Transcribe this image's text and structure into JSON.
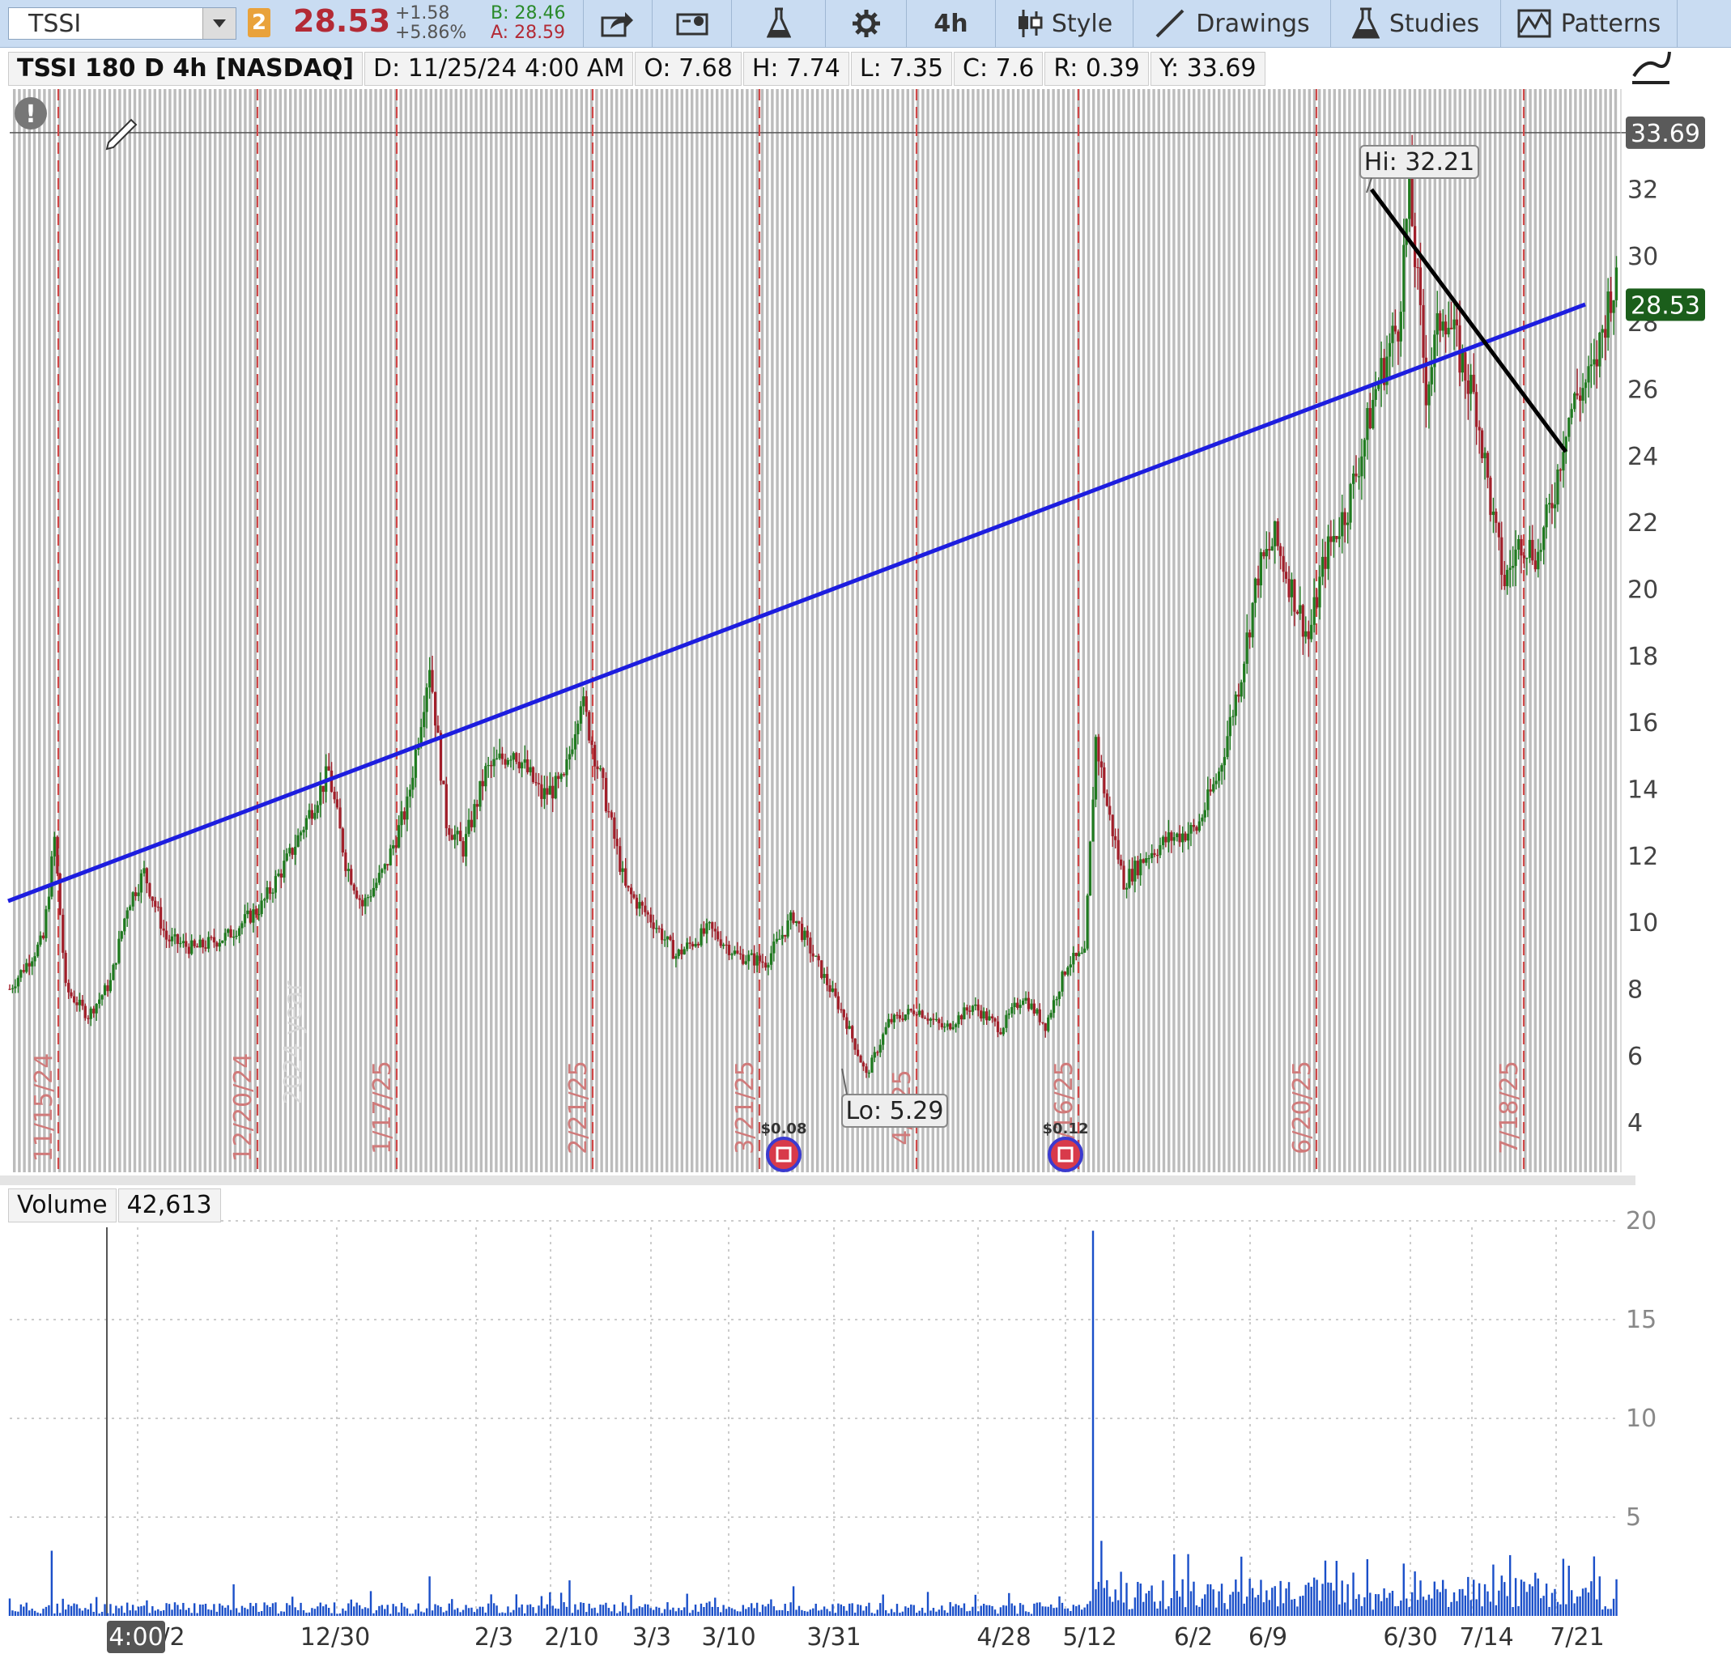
{
  "toolbar": {
    "symbol": "TSSI",
    "link_badge": "2",
    "last_price": "28.53",
    "change": "+1.58",
    "change_pct": "+5.86%",
    "bid": "B: 28.46",
    "ask": "A: 28.59",
    "timeframe": "4h",
    "style_label": "Style",
    "drawings_label": "Drawings",
    "studies_label": "Studies",
    "patterns_label": "Patterns",
    "colors": {
      "bid": "#2a8a2a",
      "ask": "#b32a35",
      "last": "#b32a35"
    }
  },
  "info": {
    "title": "TSSI 180 D 4h [NASDAQ]",
    "date": "D: 11/25/24 4:00 AM",
    "open": "O: 7.68",
    "high": "H: 7.74",
    "low": "L: 7.35",
    "close": "C: 7.6",
    "range": "R: 0.39",
    "cursor_y": "Y: 33.69"
  },
  "volume_panel": {
    "label": "Volume",
    "value": "42,613"
  },
  "chart_data": {
    "type": "candlestick",
    "symbol": "TSSI",
    "interval": "4h",
    "y_range": [
      2.5,
      35
    ],
    "y_ticks": [
      4,
      6,
      8,
      10,
      12,
      14,
      16,
      18,
      20,
      22,
      24,
      26,
      28,
      30,
      32
    ],
    "crosshair_value": "33.69",
    "last_price_label": "28.53",
    "hi_label": "Hi: 32.21",
    "lo_label": "Lo: 5.29",
    "x_tick_labels": [
      "/2",
      "12/30",
      "2/3",
      "2/10",
      "3/3",
      "3/10",
      "3/31",
      "4/28",
      "5/12",
      "6/2",
      "6/9",
      "6/30",
      "7/14",
      "7/21"
    ],
    "time_cursor_label": "4:00",
    "period_markers": [
      "11/15/24",
      "12/20/24",
      "1/17/25",
      "2/21/25",
      "3/21/25",
      "4/?/25",
      "5/16/25",
      "6/20/25",
      "7/18/25"
    ],
    "year_marker": "2024 year",
    "dividends": [
      {
        "date": "3/21/25",
        "label": "$0.08"
      },
      {
        "date": "5/12/25",
        "label": "$0.12"
      }
    ],
    "price_path": [
      [
        0,
        8.0
      ],
      [
        12,
        9.5
      ],
      [
        16,
        12.5
      ],
      [
        20,
        8.0
      ],
      [
        28,
        7.2
      ],
      [
        36,
        8.2
      ],
      [
        42,
        10.5
      ],
      [
        48,
        11.5
      ],
      [
        56,
        9.5
      ],
      [
        66,
        9.2
      ],
      [
        78,
        9.6
      ],
      [
        90,
        10.5
      ],
      [
        100,
        12.0
      ],
      [
        110,
        13.8
      ],
      [
        114,
        14.5
      ],
      [
        120,
        11.8
      ],
      [
        126,
        10.5
      ],
      [
        134,
        11.6
      ],
      [
        142,
        13.5
      ],
      [
        150,
        17.8
      ],
      [
        156,
        13.0
      ],
      [
        162,
        12.2
      ],
      [
        170,
        14.5
      ],
      [
        180,
        15.2
      ],
      [
        190,
        13.8
      ],
      [
        198,
        14.2
      ],
      [
        204,
        16.8
      ],
      [
        212,
        14.0
      ],
      [
        220,
        11.0
      ],
      [
        230,
        10.0
      ],
      [
        238,
        9.0
      ],
      [
        250,
        9.8
      ],
      [
        260,
        9.0
      ],
      [
        270,
        8.8
      ],
      [
        280,
        10.2
      ],
      [
        290,
        8.5
      ],
      [
        298,
        7.2
      ],
      [
        306,
        5.4
      ],
      [
        314,
        7.0
      ],
      [
        324,
        7.4
      ],
      [
        334,
        6.8
      ],
      [
        344,
        7.5
      ],
      [
        354,
        6.8
      ],
      [
        362,
        7.8
      ],
      [
        370,
        6.9
      ],
      [
        378,
        8.8
      ],
      [
        384,
        9.0
      ],
      [
        388,
        15.5
      ],
      [
        392,
        13.5
      ],
      [
        398,
        11.2
      ],
      [
        406,
        12.0
      ],
      [
        414,
        12.5
      ],
      [
        424,
        12.8
      ],
      [
        432,
        14.5
      ],
      [
        440,
        17.5
      ],
      [
        446,
        20.5
      ],
      [
        452,
        21.5
      ],
      [
        458,
        20.0
      ],
      [
        464,
        18.5
      ],
      [
        470,
        21.0
      ],
      [
        478,
        22.5
      ],
      [
        484,
        24.5
      ],
      [
        488,
        26.0
      ],
      [
        492,
        27.0
      ],
      [
        496,
        28.0
      ],
      [
        500,
        32.0
      ],
      [
        506,
        26.0
      ],
      [
        512,
        28.5
      ],
      [
        518,
        27.0
      ],
      [
        524,
        25.5
      ],
      [
        530,
        22.0
      ],
      [
        534,
        20.2
      ],
      [
        540,
        21.5
      ],
      [
        546,
        21.0
      ],
      [
        552,
        23.0
      ],
      [
        556,
        25.0
      ],
      [
        560,
        25.8
      ],
      [
        566,
        26.5
      ],
      [
        572,
        29.0
      ]
    ],
    "volume_y_range": [
      0,
      20
    ],
    "volume_ticks": [
      5,
      10,
      15,
      20
    ],
    "volume_spikes": [
      [
        15,
        3.3
      ],
      [
        80,
        1.6
      ],
      [
        150,
        2.0
      ],
      [
        200,
        1.8
      ],
      [
        280,
        1.5
      ],
      [
        387,
        19.5
      ],
      [
        390,
        3.8
      ],
      [
        440,
        3.0
      ],
      [
        470,
        2.8
      ],
      [
        530,
        2.6
      ],
      [
        568,
        2.0
      ]
    ],
    "trendlines": [
      {
        "color": "#1d1ddf",
        "from": [
          "11/15/24",
          10.6
        ],
        "to": [
          "7/21/25",
          28.9
        ]
      },
      {
        "color": "#000000",
        "from": [
          "Hi",
          32.3
        ],
        "to": [
          "7/18/25",
          24.3
        ]
      }
    ]
  }
}
